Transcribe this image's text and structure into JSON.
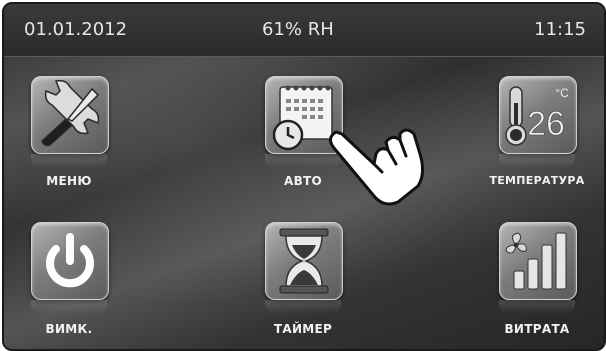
{
  "status": {
    "date": "01.01.2012",
    "humidity": "61% RH",
    "time": "11:15"
  },
  "tiles": [
    {
      "id": "menu",
      "label": "МЕНЮ",
      "icon": "tools-icon"
    },
    {
      "id": "auto",
      "label": "АВТО",
      "icon": "calendar-clock-icon"
    },
    {
      "id": "temp",
      "label": "ТЕМПЕРАТУРА",
      "icon": "thermometer-icon",
      "value": "26",
      "unit": "°C"
    },
    {
      "id": "power",
      "label": "ВИМК.",
      "icon": "power-icon"
    },
    {
      "id": "timer",
      "label": "ТАЙМЕР",
      "icon": "hourglass-icon"
    },
    {
      "id": "flow",
      "label": "ВИТРАТА",
      "icon": "fan-bars-icon"
    }
  ],
  "pointer": {
    "icon": "hand-pointer-icon"
  }
}
